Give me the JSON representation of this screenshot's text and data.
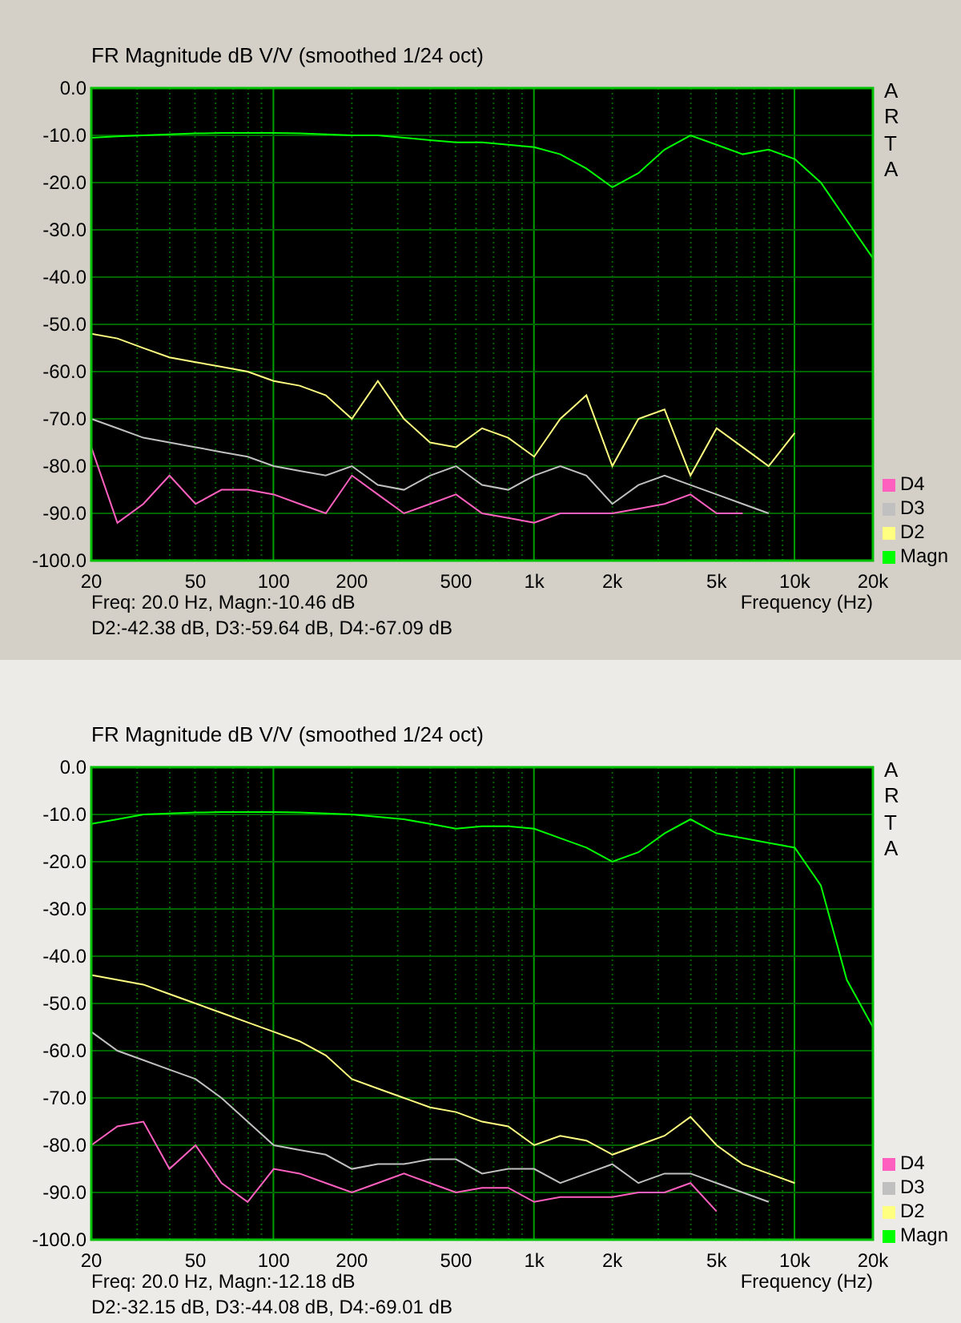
{
  "charts": [
    {
      "title": "FR Magnitude dB V/V (smoothed 1/24 oct)",
      "logo": "ARTA",
      "info_lines": [
        "Freq: 20.0 Hz, Magn:-10.46 dB",
        "D2:-42.38 dB, D3:-59.64 dB, D4:-67.09 dB"
      ],
      "chart_data": {
        "type": "line",
        "grid": true,
        "xlabel": "Frequency (Hz)",
        "categories": [
          "20",
          null,
          null,
          null,
          "50",
          null,
          null,
          "100",
          null,
          null,
          "200",
          null,
          null,
          null,
          "500",
          null,
          null,
          "1k",
          null,
          null,
          "2k",
          null,
          null,
          null,
          "5k",
          null,
          null,
          "10k",
          null,
          null,
          "20k"
        ],
        "yticks": [
          {
            "value": 0,
            "label": "0.0"
          },
          {
            "value": -10,
            "label": "-10.0"
          },
          {
            "value": -20,
            "label": "-20.0"
          },
          {
            "value": -30,
            "label": "-30.0"
          },
          {
            "value": -40,
            "label": "-40.0"
          },
          {
            "value": -50,
            "label": "-50.0"
          },
          {
            "value": -60,
            "label": "-60.0"
          },
          {
            "value": -70,
            "label": "-70.0"
          },
          {
            "value": -80,
            "label": "-80.0"
          },
          {
            "value": -90,
            "label": "-90.0"
          },
          {
            "value": -100,
            "label": "-100.0"
          }
        ],
        "ylim": [
          -100,
          0
        ],
        "series": [
          {
            "name": "Magn",
            "color": "#00ff00",
            "values": [
              -10.5,
              -10.2,
              -10,
              -9.8,
              -9.6,
              -9.5,
              -9.5,
              -9.5,
              -9.6,
              -9.8,
              -10,
              -10,
              -10.5,
              -11,
              -11.5,
              -11.5,
              -12,
              -12.5,
              -14,
              -17,
              -21,
              -18,
              -13,
              -10,
              -12,
              -14,
              -13,
              -15,
              -20,
              -28,
              -36
            ]
          },
          {
            "name": "D2",
            "color": "#ffff80",
            "values": [
              -52,
              -53,
              -55,
              -57,
              -58,
              -59,
              -60,
              -62,
              -63,
              -65,
              -70,
              -62,
              -70,
              -75,
              -76,
              -72,
              -74,
              -78,
              -70,
              -65,
              -80,
              -70,
              -68,
              -82,
              -72,
              -76,
              -80,
              -73,
              null,
              null,
              null
            ]
          },
          {
            "name": "D3",
            "color": "#c0c0c0",
            "values": [
              -70,
              -72,
              -74,
              -75,
              -76,
              -77,
              -78,
              -80,
              -81,
              -82,
              -80,
              -84,
              -85,
              -82,
              -80,
              -84,
              -85,
              -82,
              -80,
              -82,
              -88,
              -84,
              -82,
              -84,
              -86,
              -88,
              -90,
              null,
              null,
              null,
              null
            ]
          },
          {
            "name": "D4",
            "color": "#ff60c0",
            "values": [
              -76,
              -92,
              -88,
              -82,
              -88,
              -85,
              -85,
              -86,
              -88,
              -90,
              -82,
              -86,
              -90,
              -88,
              -86,
              -90,
              -91,
              -92,
              -90,
              -90,
              -90,
              -89,
              -88,
              -86,
              -90,
              -90,
              null,
              null,
              null,
              null,
              null
            ]
          }
        ]
      }
    },
    {
      "title": "FR Magnitude dB V/V (smoothed 1/24 oct)",
      "logo": "ARTA",
      "info_lines": [
        "Freq: 20.0 Hz, Magn:-12.18 dB",
        "D2:-32.15 dB, D3:-44.08 dB, D4:-69.01 dB"
      ],
      "chart_data": {
        "type": "line",
        "grid": true,
        "xlabel": "Frequency (Hz)",
        "categories": [
          "20",
          null,
          null,
          null,
          "50",
          null,
          null,
          "100",
          null,
          null,
          "200",
          null,
          null,
          null,
          "500",
          null,
          null,
          "1k",
          null,
          null,
          "2k",
          null,
          null,
          null,
          "5k",
          null,
          null,
          "10k",
          null,
          null,
          "20k"
        ],
        "yticks": [
          {
            "value": 0,
            "label": "0.0"
          },
          {
            "value": -10,
            "label": "-10.0"
          },
          {
            "value": -20,
            "label": "-20.0"
          },
          {
            "value": -30,
            "label": "-30.0"
          },
          {
            "value": -40,
            "label": "-40.0"
          },
          {
            "value": -50,
            "label": "-50.0"
          },
          {
            "value": -60,
            "label": "-60.0"
          },
          {
            "value": -70,
            "label": "-70.0"
          },
          {
            "value": -80,
            "label": "-80.0"
          },
          {
            "value": -90,
            "label": "-90.0"
          },
          {
            "value": -100,
            "label": "-100.0"
          }
        ],
        "ylim": [
          -100,
          0
        ],
        "series": [
          {
            "name": "Magn",
            "color": "#00ff00",
            "values": [
              -12,
              -11,
              -10,
              -9.8,
              -9.6,
              -9.5,
              -9.5,
              -9.5,
              -9.6,
              -9.8,
              -10,
              -10.5,
              -11,
              -12,
              -13,
              -12.5,
              -12.5,
              -13,
              -15,
              -17,
              -20,
              -18,
              -14,
              -11,
              -14,
              -15,
              -16,
              -17,
              -25,
              -45,
              -55
            ]
          },
          {
            "name": "D2",
            "color": "#ffff80",
            "values": [
              -44,
              -45,
              -46,
              -48,
              -50,
              -52,
              -54,
              -56,
              -58,
              -61,
              -66,
              -68,
              -70,
              -72,
              -73,
              -75,
              -76,
              -80,
              -78,
              -79,
              -82,
              -80,
              -78,
              -74,
              -80,
              -84,
              -86,
              -88,
              null,
              null,
              null
            ]
          },
          {
            "name": "D3",
            "color": "#c0c0c0",
            "values": [
              -56,
              -60,
              -62,
              -64,
              -66,
              -70,
              -75,
              -80,
              -81,
              -82,
              -85,
              -84,
              -84,
              -83,
              -83,
              -86,
              -85,
              -85,
              -88,
              -86,
              -84,
              -88,
              -86,
              -86,
              -88,
              -90,
              -92,
              null,
              null,
              null,
              null
            ]
          },
          {
            "name": "D4",
            "color": "#ff60c0",
            "values": [
              -80,
              -76,
              -75,
              -85,
              -80,
              -88,
              -92,
              -85,
              -86,
              -88,
              -90,
              -88,
              -86,
              -88,
              -90,
              -89,
              -89,
              -92,
              -91,
              -91,
              -91,
              -90,
              -90,
              -88,
              -94,
              null,
              null,
              null,
              null,
              null,
              null
            ]
          }
        ]
      }
    }
  ]
}
